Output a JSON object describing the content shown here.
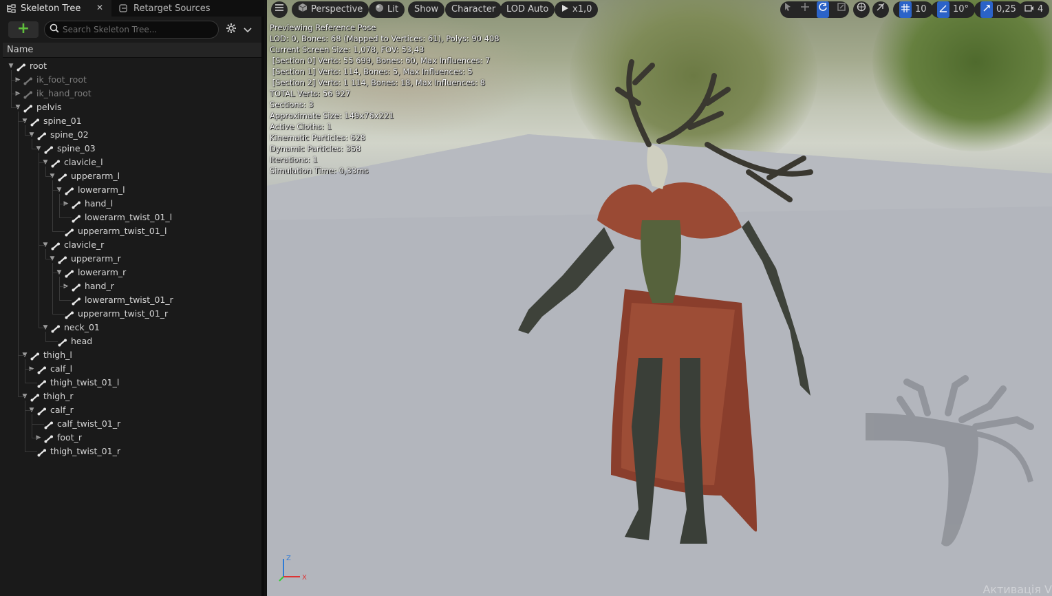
{
  "tabs": [
    {
      "label": "Skeleton Tree",
      "icon": "skeleton-tree-icon",
      "active": true
    },
    {
      "label": "Retarget Sources",
      "icon": "retarget-icon",
      "active": false
    }
  ],
  "toolbar": {
    "add_label": "+",
    "search_placeholder": "Search Skeleton Tree..."
  },
  "tree": {
    "column_header": "Name",
    "nodes": [
      {
        "label": "root",
        "depth": 0,
        "expanded": true,
        "dim": false
      },
      {
        "label": "ik_foot_root",
        "depth": 1,
        "expanded": false,
        "dim": true
      },
      {
        "label": "ik_hand_root",
        "depth": 1,
        "expanded": false,
        "dim": true
      },
      {
        "label": "pelvis",
        "depth": 1,
        "expanded": true,
        "dim": false
      },
      {
        "label": "spine_01",
        "depth": 2,
        "expanded": true,
        "dim": false
      },
      {
        "label": "spine_02",
        "depth": 3,
        "expanded": true,
        "dim": false
      },
      {
        "label": "spine_03",
        "depth": 4,
        "expanded": true,
        "dim": false
      },
      {
        "label": "clavicle_l",
        "depth": 5,
        "expanded": true,
        "dim": false
      },
      {
        "label": "upperarm_l",
        "depth": 6,
        "expanded": true,
        "dim": false
      },
      {
        "label": "lowerarm_l",
        "depth": 7,
        "expanded": true,
        "dim": false
      },
      {
        "label": "hand_l",
        "depth": 8,
        "expanded": false,
        "dim": false
      },
      {
        "label": "lowerarm_twist_01_l",
        "depth": 8,
        "expanded": null,
        "dim": false
      },
      {
        "label": "upperarm_twist_01_l",
        "depth": 7,
        "expanded": null,
        "dim": false
      },
      {
        "label": "clavicle_r",
        "depth": 5,
        "expanded": true,
        "dim": false
      },
      {
        "label": "upperarm_r",
        "depth": 6,
        "expanded": true,
        "dim": false
      },
      {
        "label": "lowerarm_r",
        "depth": 7,
        "expanded": true,
        "dim": false
      },
      {
        "label": "hand_r",
        "depth": 8,
        "expanded": false,
        "dim": false
      },
      {
        "label": "lowerarm_twist_01_r",
        "depth": 8,
        "expanded": null,
        "dim": false
      },
      {
        "label": "upperarm_twist_01_r",
        "depth": 7,
        "expanded": null,
        "dim": false
      },
      {
        "label": "neck_01",
        "depth": 5,
        "expanded": true,
        "dim": false
      },
      {
        "label": "head",
        "depth": 6,
        "expanded": null,
        "dim": false
      },
      {
        "label": "thigh_l",
        "depth": 2,
        "expanded": true,
        "dim": false
      },
      {
        "label": "calf_l",
        "depth": 3,
        "expanded": false,
        "dim": false
      },
      {
        "label": "thigh_twist_01_l",
        "depth": 3,
        "expanded": null,
        "dim": false
      },
      {
        "label": "thigh_r",
        "depth": 2,
        "expanded": true,
        "dim": false
      },
      {
        "label": "calf_r",
        "depth": 3,
        "expanded": true,
        "dim": false
      },
      {
        "label": "calf_twist_01_r",
        "depth": 4,
        "expanded": null,
        "dim": false
      },
      {
        "label": "foot_r",
        "depth": 4,
        "expanded": false,
        "dim": false
      },
      {
        "label": "thigh_twist_01_r",
        "depth": 3,
        "expanded": null,
        "dim": false
      }
    ]
  },
  "viewport": {
    "menu_icon": "hamburger-icon",
    "perspective_label": "Perspective",
    "lit_label": "Lit",
    "show_label": "Show",
    "character_label": "Character",
    "lod_label": "LOD Auto",
    "play_speed_label": "x1,0",
    "grid_snap_value": "10",
    "rotation_snap_value": "10°",
    "scale_snap_value": "0,25",
    "camera_speed_value": "4",
    "accent_color": "#2b63c8",
    "stats": [
      "Previewing Reference Pose",
      "LOD: 0, Bones: 68 (Mapped to Vertices: 61), Polys: 90 408",
      "Current Screen Size: 1,078, FOV: 53,43",
      " [Section 0] Verts: 55 699, Bones: 60, Max Influences: 7",
      " [Section 1] Verts: 114, Bones: 5, Max Influences: 5",
      " [Section 2] Verts: 1 114, Bones: 18, Max Influences: 8",
      "TOTAL Verts: 56 927",
      "Sections: 3",
      "Approximate Size: 149x76x221",
      "Active Cloths: 1",
      "Kinematic Particles: 628",
      "Dynamic Particles: 358",
      "Iterations: 1",
      "Simulation Time: 0,33ms"
    ],
    "axis_z": "Z",
    "axis_x": "X",
    "watermark": "Активація V"
  }
}
